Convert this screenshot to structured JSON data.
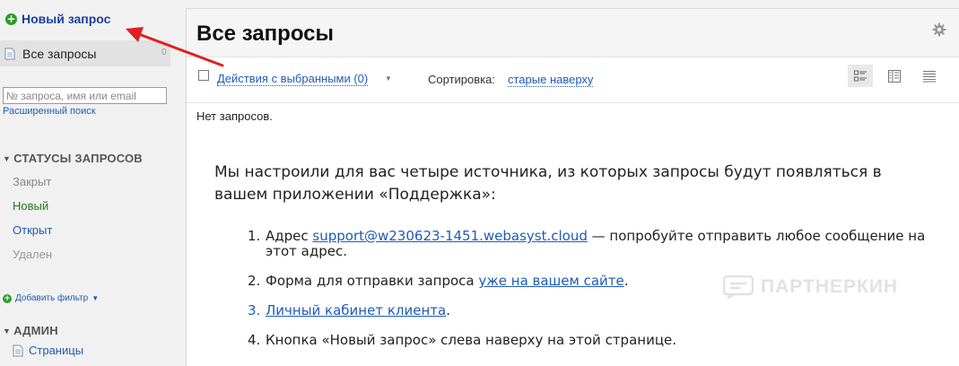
{
  "sidebar": {
    "new_request_label": "Новый запрос",
    "all_requests_label": "Все запросы",
    "all_requests_count": "0",
    "search_placeholder": "№ запроса, имя или email",
    "advanced_search_label": "Расширенный поиск",
    "statuses_header": "СТАТУСЫ ЗАПРОСОВ",
    "statuses": [
      {
        "label": "Закрыт",
        "color": "#888888"
      },
      {
        "label": "Новый",
        "color": "#1f7a1f"
      },
      {
        "label": "Открыт",
        "color": "#1f5bb7"
      },
      {
        "label": "Удален",
        "color": "#999999"
      }
    ],
    "add_filter_label": "Добавить фильтр",
    "admin_header": "АДМИН",
    "admin_items": [
      {
        "label": "Страницы"
      }
    ]
  },
  "main": {
    "title": "Все запросы",
    "toolbar": {
      "actions_label": "Действия с выбранными (0)",
      "sort_label": "Сортировка:",
      "sort_value": "старые наверху"
    },
    "empty_label": "Нет запросов.",
    "intro": "Мы настроили для вас четыре источника, из которых запросы будут появляться в вашем приложении «Поддержка»:",
    "steps": [
      {
        "num": "1.",
        "before": "Адрес ",
        "link": "support@w230623-1451.webasyst.cloud",
        "after": " — попробуйте отправить любое сообщение на этот адрес."
      },
      {
        "num": "2.",
        "before": "Форма для отправки запроса ",
        "link": "уже на вашем сайте",
        "after": "."
      },
      {
        "num": "3.",
        "before": "",
        "link": "Личный кабинет клиента",
        "after": "."
      },
      {
        "num": "4.",
        "before": "Кнопка «Новый запрос» слева наверху на этой странице.",
        "link": "",
        "after": ""
      }
    ]
  },
  "watermark": "ПАРТНЕРКИН",
  "colors": {
    "link": "#1f5bb7",
    "accent_green": "#2e9a2a",
    "arrow": "#e02020"
  }
}
